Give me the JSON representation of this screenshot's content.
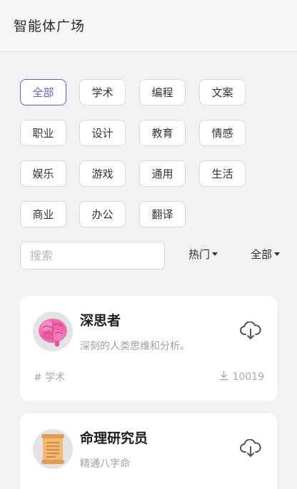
{
  "header": {
    "title": "智能体广场"
  },
  "categories": [
    {
      "label": "全部",
      "active": true
    },
    {
      "label": "学术"
    },
    {
      "label": "编程"
    },
    {
      "label": "文案"
    },
    {
      "label": "职业"
    },
    {
      "label": "设计"
    },
    {
      "label": "教育"
    },
    {
      "label": "情感"
    },
    {
      "label": "娱乐"
    },
    {
      "label": "游戏"
    },
    {
      "label": "通用"
    },
    {
      "label": "生活"
    },
    {
      "label": "商业"
    },
    {
      "label": "办公"
    },
    {
      "label": "翻译"
    }
  ],
  "search": {
    "placeholder": "搜索",
    "value": ""
  },
  "sort_filter": {
    "label": "热门"
  },
  "scope_filter": {
    "label": "全部"
  },
  "agents": [
    {
      "name": "深思者",
      "description": "深刻的人类思维和分析。",
      "tag": "# 学术",
      "downloads": "10019",
      "avatar_icon": "brain-icon",
      "download_icon": "cloud-download-icon"
    },
    {
      "name": "命理研究员",
      "description": "精通八字命",
      "avatar_icon": "scroll-icon",
      "download_icon": "cloud-download-icon"
    }
  ],
  "colors": {
    "accent": "#6a5acd",
    "background": "#f2f2f4"
  }
}
